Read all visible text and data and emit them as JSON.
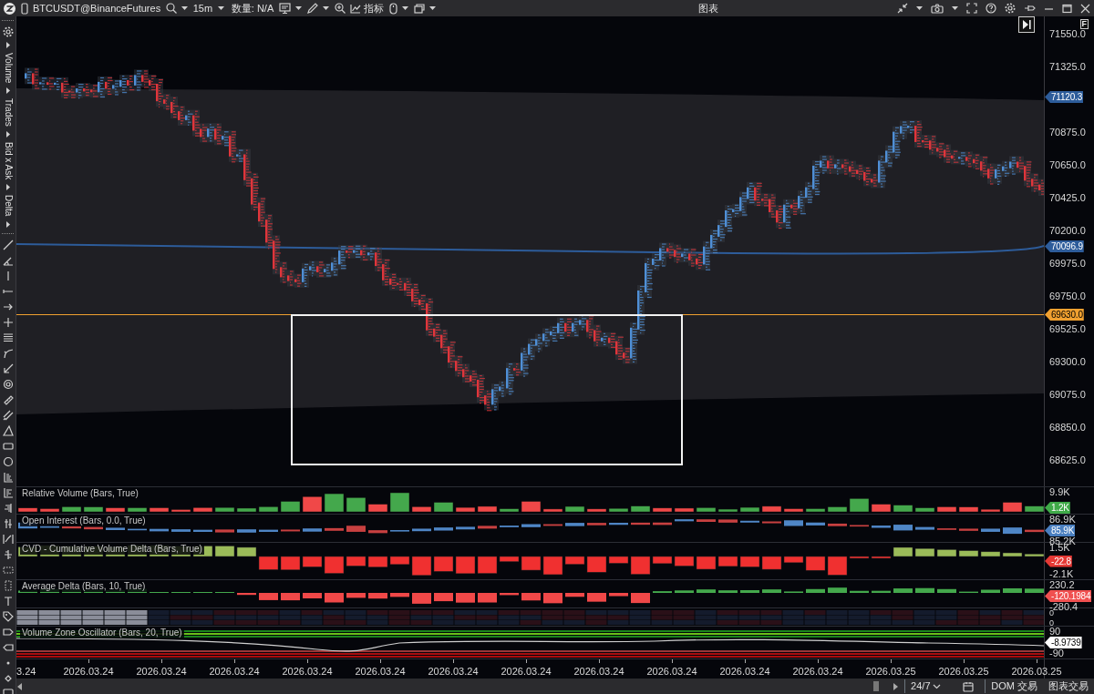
{
  "toolbar": {
    "instrument": "BTCUSDT@BinanceFutures",
    "timeframe": "15m",
    "quantity": "数量: N/A",
    "indicators_button": "指标",
    "title": "图表"
  },
  "sidebar": {
    "sections": [
      "Volume",
      "Trades",
      "Bid x Ask",
      "Delta"
    ]
  },
  "chart": {
    "axis_button": "F",
    "price_ticks": [
      "71550.0",
      "71325.0",
      "70875.0",
      "70650.0",
      "70425.0",
      "70200.0",
      "69975.0",
      "69750.0",
      "69525.0",
      "69300.0",
      "69075.0",
      "68850.0",
      "68625.0"
    ],
    "price_tags": [
      {
        "text": "71120.3",
        "color": "#2d5c9a"
      },
      {
        "text": "70096.9",
        "color": "#2d5c9a"
      },
      {
        "text": "69630.0",
        "color": "#f0a030"
      }
    ]
  },
  "panes": [
    {
      "title": "Relative Volume (Bars, True)",
      "axis": [
        {
          "text": "9.9K",
          "kind": "tick"
        },
        {
          "text": "1.2K",
          "kind": "tag",
          "color": "#3faa48"
        }
      ]
    },
    {
      "title": "Open Interest (Bars, 0.0, True)",
      "axis": [
        {
          "text": "86.9K",
          "kind": "tick"
        },
        {
          "text": "85.9K",
          "kind": "tag",
          "color": "#4a7fc0"
        },
        {
          "text": "85.2K",
          "kind": "tick"
        }
      ]
    },
    {
      "title": "CVD - Cumulative Volume Delta (Bars, True)",
      "axis": [
        {
          "text": "1.5K",
          "kind": "tick"
        },
        {
          "text": "-22.8",
          "kind": "tag",
          "color": "#e53935"
        },
        {
          "text": "-2.1K",
          "kind": "tick"
        }
      ]
    },
    {
      "title": "Average Delta (Bars, 10, True)",
      "axis": [
        {
          "text": "230.2",
          "kind": "tick"
        },
        {
          "text": "-120.1984",
          "kind": "tag",
          "color": "#f05050"
        },
        {
          "text": "-280.4",
          "kind": "tick"
        }
      ]
    },
    {
      "axis": [
        {
          "text": "0",
          "kind": "tick"
        },
        {
          "text": "0",
          "kind": "tick"
        }
      ]
    },
    {
      "title": "Volume Zone Oscillator (Bars, 20, True)",
      "axis": [
        {
          "text": "90",
          "kind": "tick"
        },
        {
          "text": "-8.9739",
          "kind": "tag",
          "color": "#ffffff"
        },
        {
          "text": "-90",
          "kind": "tick"
        }
      ]
    }
  ],
  "time_axis": [
    "3.24",
    "2026.03.24",
    "2026.03.24",
    "2026.03.24",
    "2026.03.24",
    "2026.03.24",
    "2026.03.24",
    "2026.03.24",
    "2026.03.24",
    "2026.03.24",
    "2026.03.24",
    "2026.03.24",
    "2026.03.25",
    "2026.03.25",
    "2026.03.25"
  ],
  "status_bar": {
    "session": "24/7",
    "buttons": [
      "DOM 交易",
      "图表交易"
    ]
  }
}
